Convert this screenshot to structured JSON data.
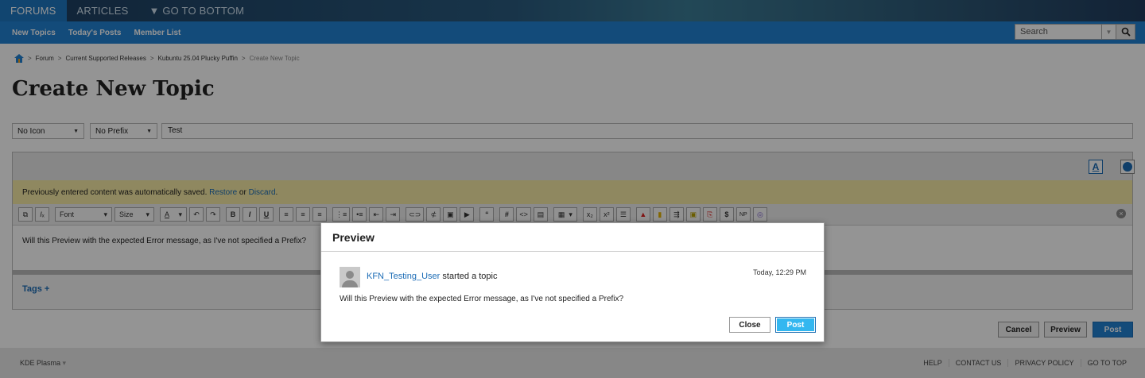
{
  "topnav": {
    "tabs": [
      "FORUMS",
      "ARTICLES",
      "▼ GO TO BOTTOM"
    ]
  },
  "subnav": {
    "links": [
      "New Topics",
      "Today's Posts",
      "Member List"
    ],
    "search_placeholder": "Search"
  },
  "breadcrumb": {
    "items": [
      "Forum",
      "Current Supported Releases",
      "Kubuntu 25.04 Plucky Puffin"
    ],
    "current": "Create New Topic"
  },
  "page_title": "Create New Topic",
  "form": {
    "icon_select": "No Icon",
    "prefix_select": "No Prefix",
    "title_value": "Test"
  },
  "editor": {
    "autosave_text": "Previously entered content was automatically saved.",
    "restore_link": "Restore",
    "or_text": "or",
    "discard_link": "Discard",
    "font_label": "Font",
    "size_label": "Size",
    "body_text": "Will this Preview with the expected Error message, as I've not specified a Prefix?",
    "tags_label": "Tags +"
  },
  "actions": {
    "cancel": "Cancel",
    "preview": "Preview",
    "post": "Post"
  },
  "footer": {
    "left": "KDE Plasma",
    "links": [
      "HELP",
      "CONTACT US",
      "PRIVACY POLICY",
      "GO TO TOP"
    ]
  },
  "modal": {
    "title": "Preview",
    "username": "KFN_Testing_User",
    "action_text": "started a topic",
    "timestamp": "Today, 12:29 PM",
    "post_text": "Will this Preview with the expected Error message, as I've not specified a Prefix?",
    "close_label": "Close",
    "post_label": "Post"
  },
  "colors": {
    "accent": "#2281d3",
    "autosave_bg": "#f7eba5",
    "post_button": "#33b7f0"
  }
}
